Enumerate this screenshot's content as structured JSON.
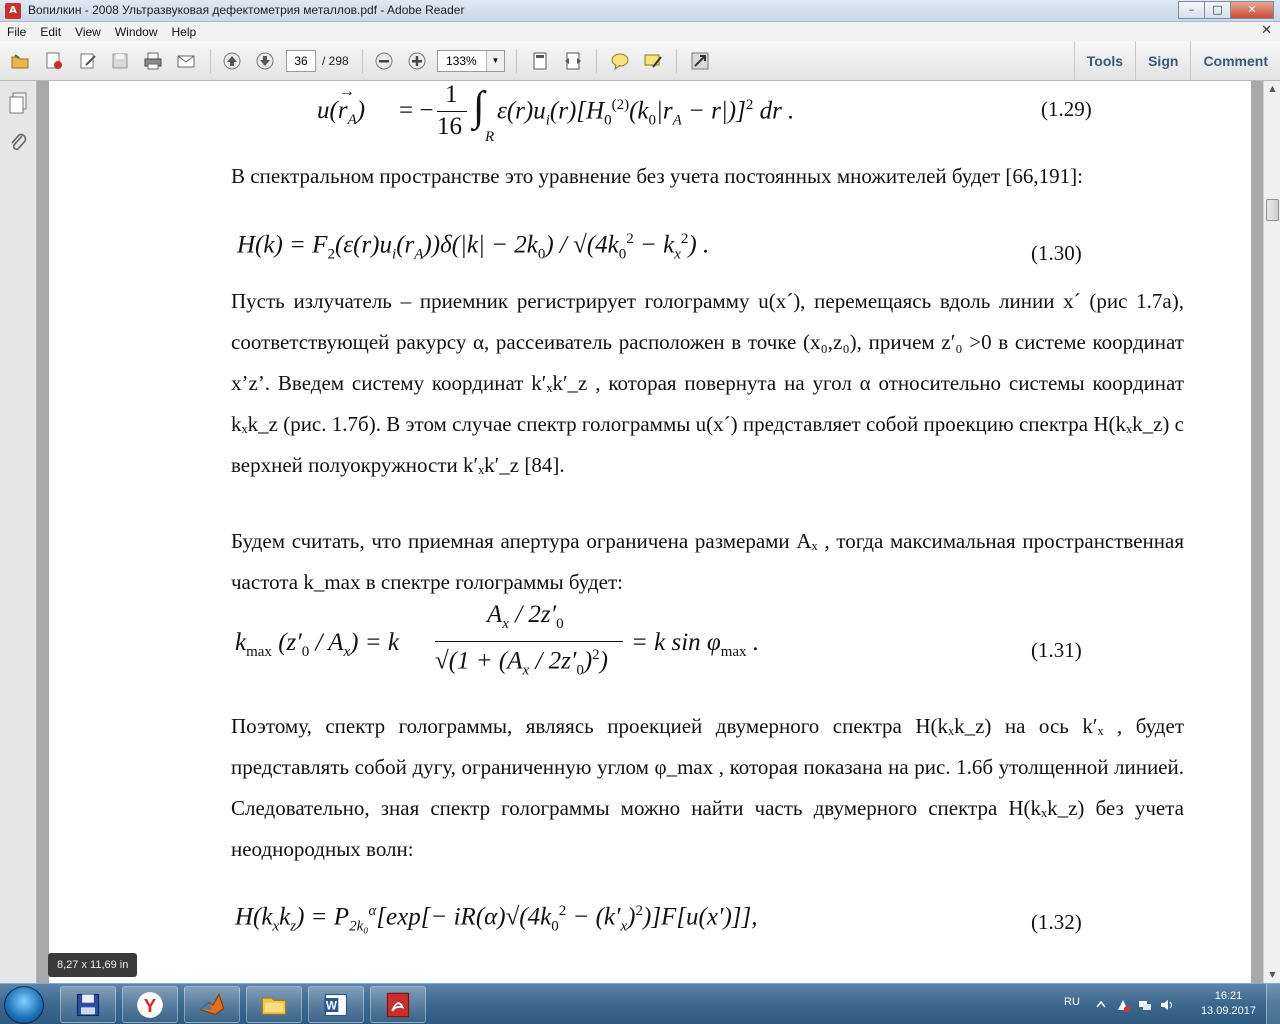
{
  "window": {
    "title": "Вопилкин - 2008 Ультразвуковая дефектометрия металлов.pdf - Adobe Reader",
    "app_icon": "adobe-reader-icon",
    "minimize": "–",
    "maximize": "□",
    "close": "✕"
  },
  "menu": {
    "items": [
      "File",
      "Edit",
      "View",
      "Window",
      "Help"
    ],
    "close": "✕"
  },
  "toolbar": {
    "page_current": "36",
    "page_total": "/ 298",
    "zoom": "133%",
    "links": [
      "Tools",
      "Sign",
      "Comment"
    ]
  },
  "document": {
    "eq129_number": "(1.29)",
    "para1": "В спектральном пространстве это уравнение без учета постоянных множителей будет [66,191]:",
    "eq130_number": "(1.30)",
    "para2": "Пусть излучатель – приемник регистрирует голограмму u(x´), перемещаясь вдоль линии x´ (рис 1.7а), соответствующей ракурсу α, рассеиватель расположен в точке (x₀,z₀), причем z′₀ >0 в системе координат x’z’. Введем систему координат k′ₓk′_z , которая повернута на угол α относительно системы координат kₓk_z (рис. 1.7б). В этом случае спектр голограммы u(x´) представляет собой проекцию спектра H(kₓk_z) с верхней полуокружности k′ₓk′_z [84].",
    "para3": "Будем считать, что приемная апертура ограничена размерами Aₓ , тогда максимальная пространственная частота k_max в спектре голограммы будет:",
    "eq131_number": "(1.31)",
    "para4": "Поэтому, спектр голограммы, являясь проекцией двумерного спектра H(kₓk_z) на ось k′ₓ , будет представлять собой дугу, ограниченную углом φ_max , которая показана на рис. 1.6б утолщенной линией. Следовательно, зная спектр голограммы можно найти часть двумерного спектра H(kₓk_z) без учета неоднородных волн:",
    "eq132_number": "(1.32)"
  },
  "page_size_tip": "8,27 x 11,69 in",
  "taskbar": {
    "lang": "RU",
    "time": "16:21",
    "date": "13.09.2017",
    "items": [
      "save-icon",
      "yandex-icon",
      "matlab-icon",
      "folder-icon",
      "word-icon",
      "acrobat-icon"
    ]
  }
}
